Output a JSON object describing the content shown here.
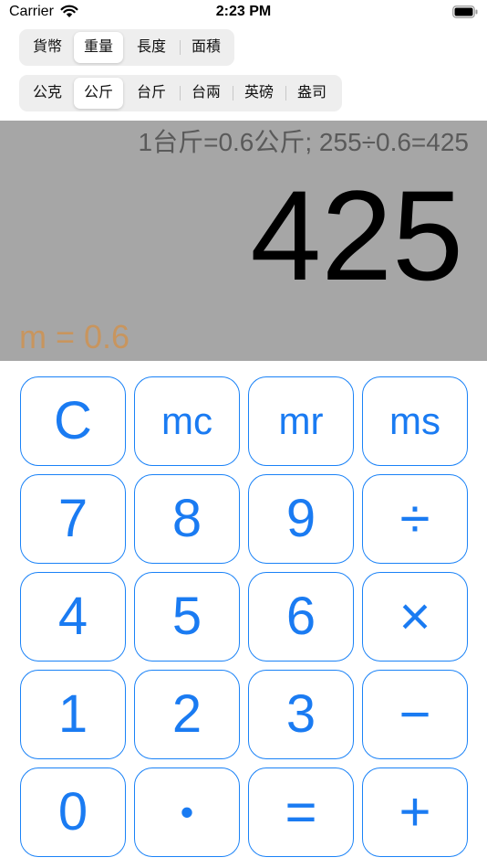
{
  "status_bar": {
    "carrier": "Carrier",
    "time": "2:23 PM"
  },
  "categories": {
    "items": [
      "貨幣",
      "重量",
      "長度",
      "面積"
    ],
    "selected": "重量"
  },
  "units": {
    "items": [
      "公克",
      "公斤",
      "台斤",
      "台兩",
      "英磅",
      "盎司"
    ],
    "selected": "公斤"
  },
  "display": {
    "formula": "1台斤=0.6公斤; 255÷0.6=425",
    "result": "425",
    "memory": "m = 0.6"
  },
  "keys": {
    "clear": "C",
    "mc": "mc",
    "mr": "mr",
    "ms": "ms",
    "seven": "7",
    "eight": "8",
    "nine": "9",
    "divide": "÷",
    "four": "4",
    "five": "5",
    "six": "6",
    "multiply": "×",
    "one": "1",
    "two": "2",
    "three": "3",
    "minus": "−",
    "zero": "0",
    "dot": "•",
    "equals": "=",
    "plus": "+"
  },
  "colors": {
    "accent": "#1a7bf2",
    "display_bg": "#a6a6a6",
    "memory_text": "#c8955e",
    "formula_text": "#5a5a5a"
  }
}
